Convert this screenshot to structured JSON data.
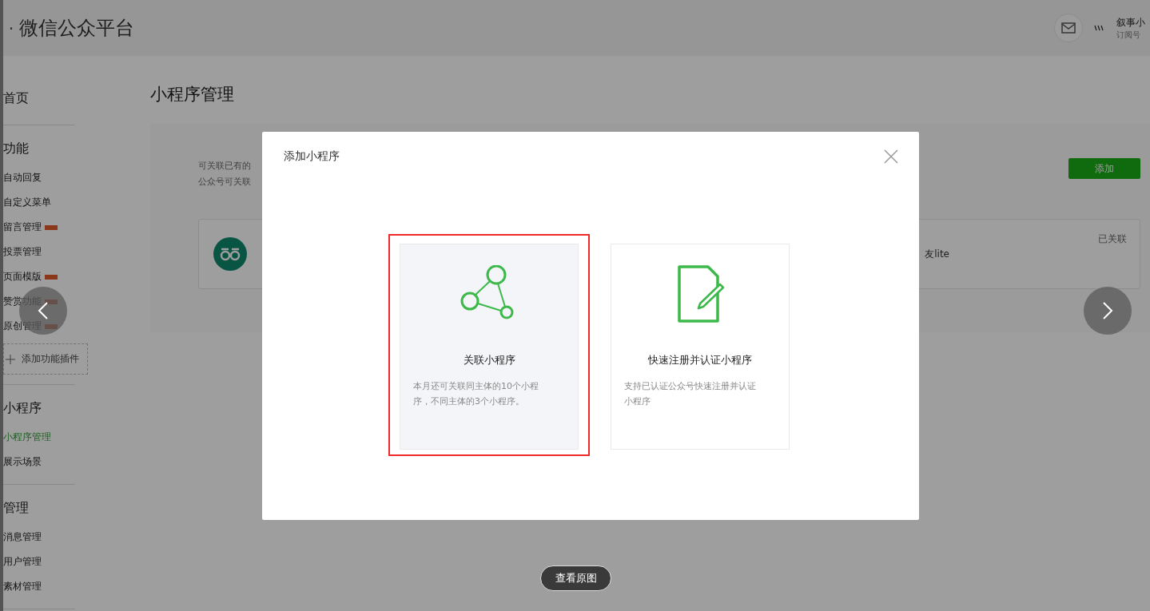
{
  "header": {
    "dot": "·",
    "logo_title": "微信公众平台",
    "account_name": "叙事小",
    "account_type": "订阅号"
  },
  "sidebar": {
    "sections": [
      {
        "title": "首页"
      },
      {
        "title": "功能",
        "items": [
          {
            "label": "自动回复",
            "badge": false,
            "selected": false
          },
          {
            "label": "自定义菜单",
            "badge": false,
            "selected": false
          },
          {
            "label": "留言管理",
            "badge": true,
            "selected": false
          },
          {
            "label": "投票管理",
            "badge": false,
            "selected": false
          },
          {
            "label": "页面模版",
            "badge": true,
            "selected": false
          },
          {
            "label": "赞赏功能",
            "badge": true,
            "selected": false
          },
          {
            "label": "原创管理",
            "badge": true,
            "selected": false
          }
        ],
        "plugin_button": "添加功能插件"
      },
      {
        "title": "小程序",
        "items": [
          {
            "label": "小程序管理",
            "badge": false,
            "selected": true
          },
          {
            "label": "展示场景",
            "badge": false,
            "selected": false
          }
        ]
      },
      {
        "title": "管理",
        "items": [
          {
            "label": "消息管理",
            "badge": false,
            "selected": false
          },
          {
            "label": "用户管理",
            "badge": false,
            "selected": false
          },
          {
            "label": "素材管理",
            "badge": false,
            "selected": false
          }
        ]
      }
    ]
  },
  "main": {
    "title": "小程序管理",
    "description": [
      "可关联已有的",
      "公众号可关联"
    ],
    "add_button": "添加",
    "linked_items": [
      {
        "name": "友lite",
        "status": "已关联"
      }
    ]
  },
  "dialog": {
    "title": "添加小程序",
    "options": [
      {
        "kind": "link",
        "title": "关联小程序",
        "description": "本月还可关联同主体的10个小程序，不同主体的3个小程序。",
        "selected": true
      },
      {
        "kind": "register",
        "title": "快速注册并认证小程序",
        "description": "支持已认证公众号快速注册并认证小程序",
        "selected": false
      }
    ]
  },
  "viewer": {
    "view_original_button": "查看原图"
  }
}
